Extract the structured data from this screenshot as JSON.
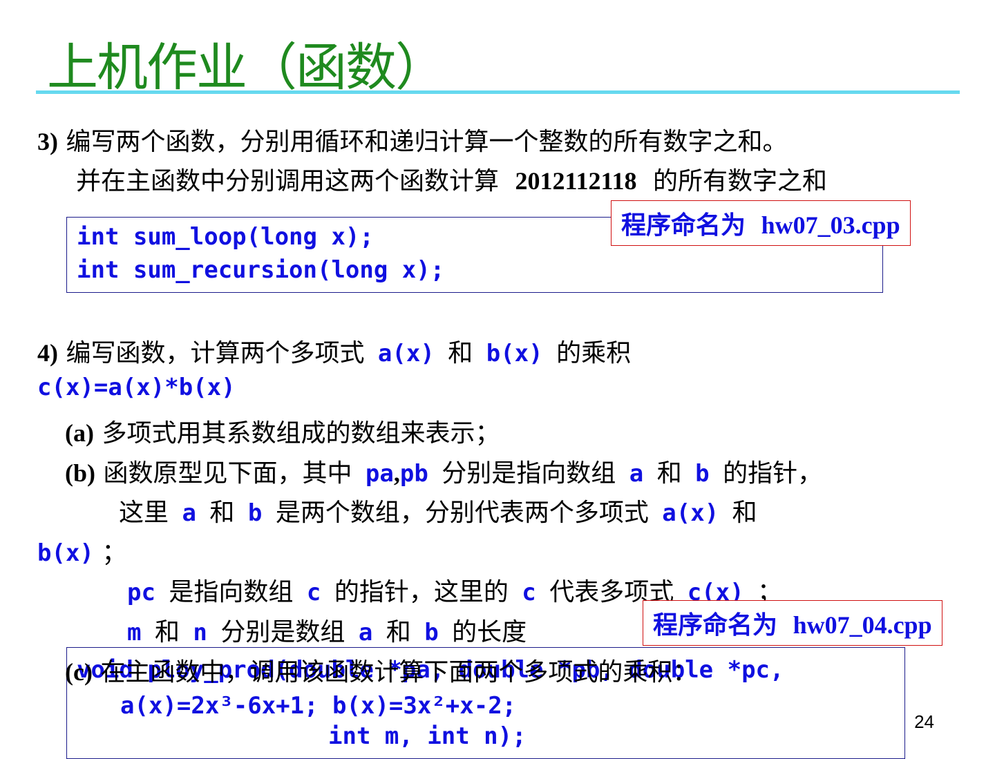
{
  "slide": {
    "title": "上机作业（函数）",
    "page_number": "24"
  },
  "q3": {
    "num": "3)",
    "line1": "编写两个函数，分别用循环和递归计算一个整数的所有数字之和。",
    "line2a": "并在主函数中分别调用这两个函数计算",
    "line2num": "2012112118",
    "line2b": "的所有数字之和",
    "filename_label": "程序命名为",
    "filename": "hw07_03.cpp",
    "code1": "int sum_loop(long x);",
    "code2": "int sum_recursion(long x);"
  },
  "q4": {
    "num": "4)",
    "line1a": "编写函数，计算两个多项式",
    "ax": "a(x)",
    "and": "和",
    "bx": "b(x)",
    "line1b": "的乘积",
    "cx_formula": "c(x)=a(x)*b(x)",
    "a_num": "(a)",
    "a_text": "多项式用其系数组成的数组来表示；",
    "b_num": "(b)",
    "b_text1": "函数原型见下面，其中",
    "pa": "pa",
    "comma": ",",
    "pb": "pb",
    "b_text2": "分别是指向数组",
    "a": "a",
    "b": "b",
    "b_text3": "的指针，",
    "b_text4": "这里",
    "b_text5": "是两个数组，分别代表两个多项式",
    "semicolon": "；",
    "pc": "pc",
    "pc_text1": "是指向数组",
    "c": "c",
    "pc_text2": "的指针，这里的",
    "pc_text3": "代表多项式",
    "c_x": "c(x)",
    "m": "m",
    "n": "n",
    "mn_text1": "分别是数组",
    "mn_text2": "的长度",
    "filename_label": "程序命名为",
    "filename": "hw07_04.cpp",
    "code1": "void ploy_prod(double *pa, double *pb, double *pc,",
    "code2": "int m, int n);",
    "c_num": "(c)",
    "c_text": "在主函数中，调用该函数计算下面两个多项式的乘积：",
    "formula": "a(x)=2x³-6x+1; b(x)=3x²+x-2;"
  }
}
